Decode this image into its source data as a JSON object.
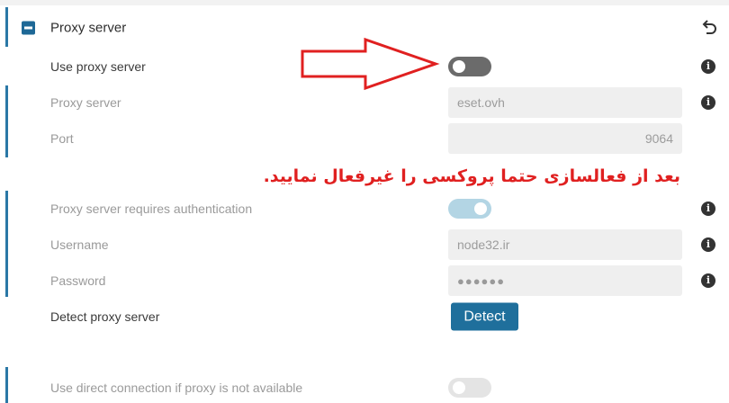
{
  "section": {
    "title": "Proxy server"
  },
  "rows": {
    "use_proxy": {
      "label": "Use proxy server"
    },
    "proxy_server": {
      "label": "Proxy server",
      "value": "eset.ovh"
    },
    "port": {
      "label": "Port",
      "value": "9064"
    },
    "auth": {
      "label": "Proxy server requires authentication"
    },
    "username": {
      "label": "Username",
      "value": "node32.ir"
    },
    "password": {
      "label": "Password",
      "value": "●●●●●●"
    },
    "detect": {
      "label": "Detect proxy server",
      "button": "Detect"
    },
    "direct": {
      "label": "Use direct connection if proxy is not available"
    }
  },
  "annotation": {
    "text": "بعد از فعالسازی حتما پروکسی را غیرفعال نمایید."
  },
  "info_glyph": "i",
  "colors": {
    "accent": "#2b78a6",
    "button": "#1f6f9c",
    "annotation": "#e02020"
  }
}
